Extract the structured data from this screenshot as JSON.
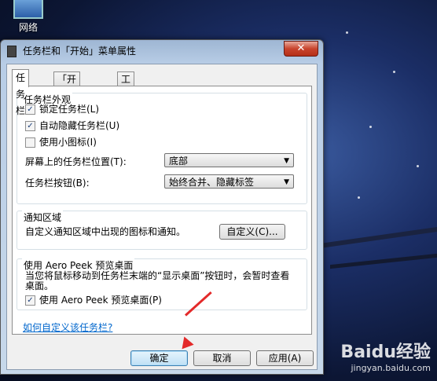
{
  "desktop": {
    "icon_label": "网络"
  },
  "window": {
    "title": "任务栏和「开始」菜单属性",
    "close_label": "✕",
    "tabs": [
      {
        "label": "任务栏"
      },
      {
        "label": "「开始」菜单"
      },
      {
        "label": "工具栏"
      }
    ]
  },
  "appearance": {
    "title": "任务栏外观",
    "lock": {
      "label": "锁定任务栏(L)",
      "checked": true
    },
    "autohide": {
      "label": "自动隐藏任务栏(U)",
      "checked": true
    },
    "small_icons": {
      "label": "使用小图标(I)",
      "checked": false
    },
    "location_label": "屏幕上的任务栏位置(T):",
    "location_value": "底部",
    "buttons_label": "任务栏按钮(B):",
    "buttons_value": "始终合并、隐藏标签"
  },
  "notify": {
    "title": "通知区域",
    "desc": "自定义通知区域中出现的图标和通知。",
    "customize_label": "自定义(C)..."
  },
  "peek": {
    "title": "使用 Aero Peek 预览桌面",
    "desc": "当您将鼠标移动到任务栏末端的“显示桌面”按钮时，会暂时查看桌面。",
    "checkbox": {
      "label": "使用 Aero Peek 预览桌面(P)",
      "checked": true
    }
  },
  "help_link": "如何自定义该任务栏?",
  "footer": {
    "ok": "确定",
    "cancel": "取消",
    "apply": "应用(A)"
  },
  "watermark": {
    "logo": "Baidu经验",
    "url": "jingyan.baidu.com"
  }
}
